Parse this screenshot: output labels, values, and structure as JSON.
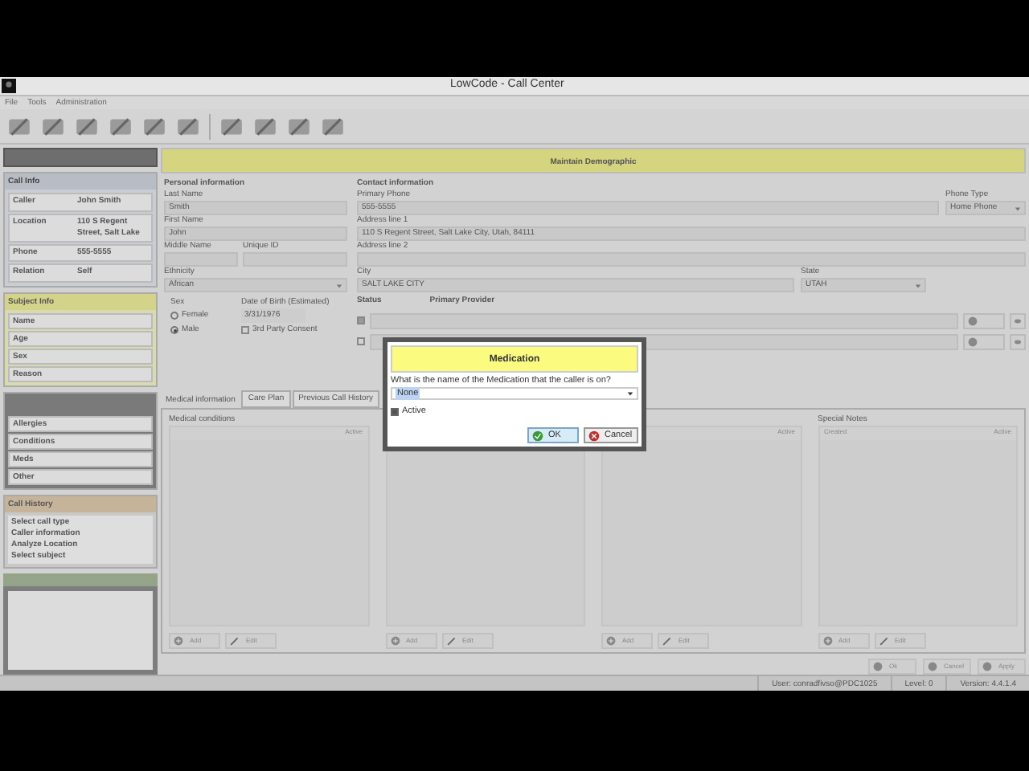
{
  "window": {
    "title": "LowCode - Call Center"
  },
  "menu": [
    "File",
    "Tools",
    "Administration"
  ],
  "sidebar": {
    "call_info": {
      "title": "Call Info",
      "rows": [
        {
          "label": "Caller",
          "value": "John Smith"
        },
        {
          "label": "Location",
          "value": "110 S Regent Street, Salt Lake"
        },
        {
          "label": "Phone",
          "value": "555-5555"
        },
        {
          "label": "Relation",
          "value": "Self"
        }
      ]
    },
    "subject_info": {
      "title": "Subject Info",
      "rows": [
        "Name",
        "Age",
        "Sex",
        "Reason"
      ]
    },
    "medical_links": [
      "Allergies",
      "Conditions",
      "Meds",
      "Other"
    ],
    "call_history": {
      "title": "Call History",
      "items": [
        "Select call type",
        "Caller information",
        "Analyze Location",
        "Select subject"
      ]
    }
  },
  "banner": "Maintain Demographic",
  "personal": {
    "title": "Personal information",
    "last_name": {
      "label": "Last Name",
      "value": "Smith"
    },
    "first_name": {
      "label": "First Name",
      "value": "John"
    },
    "middle_name": {
      "label": "Middle Name"
    },
    "unique_id": {
      "label": "Unique ID"
    },
    "ethnicity": {
      "label": "Ethnicity",
      "value": "African"
    },
    "sex": {
      "label": "Sex",
      "options": [
        {
          "label": "Female",
          "selected": false
        },
        {
          "label": "Male",
          "selected": true
        }
      ]
    },
    "dob": {
      "label": "Date of Birth (Estimated)",
      "value": "3/31/1976"
    },
    "consent": {
      "label": "3rd Party Consent",
      "checked": false
    }
  },
  "contact": {
    "title": "Contact information",
    "primary_phone": {
      "label": "Primary Phone",
      "value": "555-5555"
    },
    "phone_type": {
      "label": "Phone Type",
      "value": "Home Phone"
    },
    "address1": {
      "label": "Address line 1",
      "value": "110 S Regent Street, Salt Lake City, Utah, 84111"
    },
    "address2": {
      "label": "Address line 2"
    },
    "city": {
      "label": "City",
      "value": "SALT LAKE CITY"
    },
    "state": {
      "label": "State",
      "value": "UTAH"
    }
  },
  "status": {
    "label": "Status",
    "provider_label": "Primary Provider",
    "rows": [
      {
        "checked": true
      },
      {
        "checked": false
      }
    ]
  },
  "tabs": [
    {
      "label": "Medical information",
      "selected": true
    },
    {
      "label": "Care Plan",
      "selected": false
    },
    {
      "label": "Previous Call History",
      "selected": false
    }
  ],
  "panels": [
    {
      "title": "Medical conditions",
      "columns": [
        "Active"
      ],
      "buttons": [
        "Add",
        "Edit"
      ]
    },
    {
      "buttons": [
        "Add",
        "Edit"
      ]
    },
    {
      "columns": [
        "Active"
      ],
      "buttons": [
        "Add",
        "Edit"
      ]
    },
    {
      "title": "Special Notes",
      "columns": [
        "Created",
        "Active"
      ],
      "buttons": [
        "Add",
        "Edit"
      ]
    }
  ],
  "actions": [
    "Ok",
    "Cancel",
    "Apply"
  ],
  "status_bar": [
    "User: conradfivso@PDC1025",
    "Level: 0",
    "Version: 4.4.1.4"
  ],
  "dialog": {
    "title": "Medication",
    "question": "What is the name of the Medication that the caller is on?",
    "value": "None",
    "active": {
      "label": "Active",
      "checked": true
    },
    "buttons": [
      {
        "label": "OK",
        "kind": "ok"
      },
      {
        "label": "Cancel",
        "kind": "cancel"
      }
    ]
  }
}
